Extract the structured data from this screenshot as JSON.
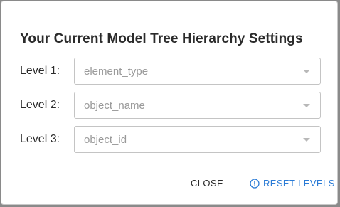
{
  "dialog": {
    "title": "Your Current Model Tree Hierarchy Settings",
    "levels": [
      {
        "label": "Level 1:",
        "value": "element_type",
        "icon": "chevron-down-icon"
      },
      {
        "label": "Level 2:",
        "value": "object_name",
        "icon": "chevron-down-icon"
      },
      {
        "label": "Level 3:",
        "value": "object_id",
        "icon": "chevron-down-icon"
      }
    ],
    "actions": {
      "close_label": "CLOSE",
      "reset_label": "RESET LEVELS",
      "reset_icon": "alert-circle-icon"
    }
  },
  "colors": {
    "accent": "#2a7bd6",
    "text": "#2b2b2b",
    "placeholder": "#9a9a9a",
    "backdrop": "#8a8a8a"
  }
}
